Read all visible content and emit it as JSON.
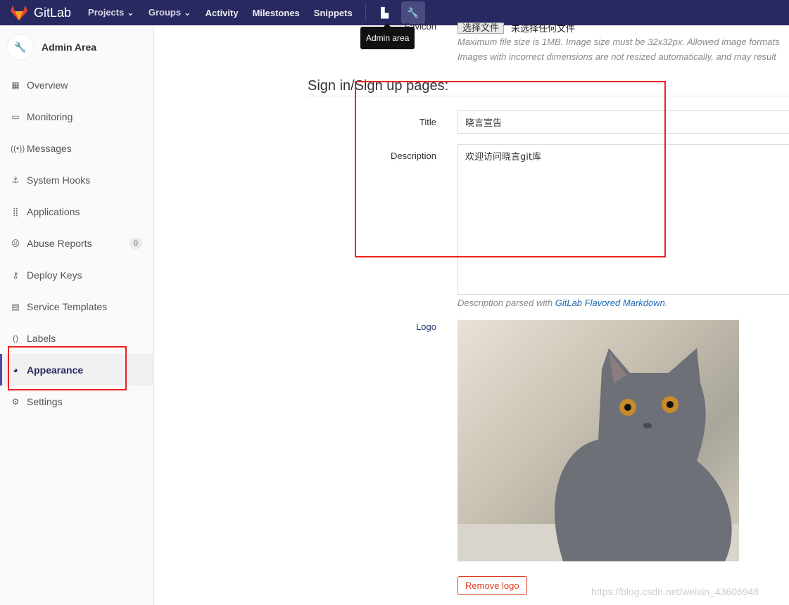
{
  "topbar": {
    "brand": "GitLab",
    "nav": [
      "Projects",
      "Groups",
      "Activity",
      "Milestones",
      "Snippets"
    ],
    "tooltip": "Admin area"
  },
  "sidebar": {
    "title": "Admin Area",
    "items": [
      {
        "label": "Overview",
        "icon": "grid-icon"
      },
      {
        "label": "Monitoring",
        "icon": "monitor-icon"
      },
      {
        "label": "Messages",
        "icon": "broadcast-icon"
      },
      {
        "label": "System Hooks",
        "icon": "hook-icon"
      },
      {
        "label": "Applications",
        "icon": "apps-icon"
      },
      {
        "label": "Abuse Reports",
        "icon": "face-icon",
        "badge": "0"
      },
      {
        "label": "Deploy Keys",
        "icon": "key-icon"
      },
      {
        "label": "Service Templates",
        "icon": "template-icon"
      },
      {
        "label": "Labels",
        "icon": "labels-icon"
      },
      {
        "label": "Appearance",
        "icon": "palette-icon",
        "active": true
      },
      {
        "label": "Settings",
        "icon": "gear-icon"
      }
    ]
  },
  "favicon": {
    "label": "Favicon",
    "button": "选择文件",
    "no_file": "未选择任何文件",
    "help1": "Maximum file size is 1MB. Image size must be 32x32px. Allowed image formats",
    "help2": "Images with incorrect dimensions are not resized automatically, and may result"
  },
  "signin": {
    "heading": "Sign in/Sign up pages:",
    "title_label": "Title",
    "title_value": "晓言宣告",
    "desc_label": "Description",
    "desc_value": "欢迎访问晓言git库",
    "help_prefix": "Description parsed with ",
    "help_link": "GitLab Flavored Markdown",
    "help_suffix": ".",
    "logo_label": "Logo",
    "remove_logo": "Remove logo"
  },
  "watermark": "https://blog.csdn.net/weixin_43606948"
}
